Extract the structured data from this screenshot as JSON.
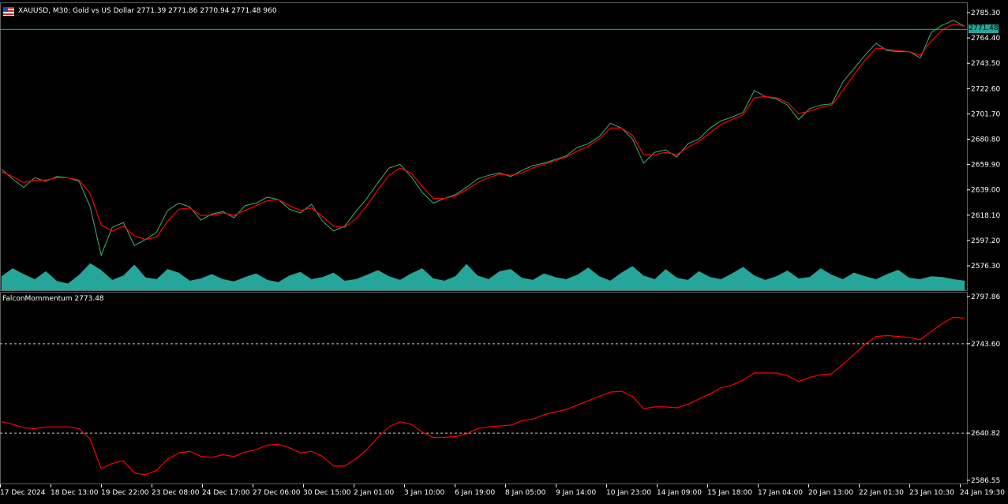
{
  "window": {
    "symbol": "XAUUSD",
    "timeframe": "M30",
    "description": "Gold vs US Dollar",
    "ohlc": [
      "2771.39",
      "2771.86",
      "2770.94",
      "2771.48"
    ],
    "volume": "960",
    "header_text": "XAUUSD, M30:  Gold vs US Dollar  2771.39 2771.86 2770.94 2771.48  960",
    "current_price_label": "2771.48"
  },
  "indicator": {
    "name": "FalconMommentum",
    "value": "2773.48",
    "header_text": "FalconMommentum 2773.48"
  },
  "colors": {
    "background": "#000000",
    "price_line": "#3cb371",
    "moving_average": "#ff0000",
    "volume": "#26a69a",
    "indicator_line": "#ff0000",
    "current_price_bg": "#26a69a",
    "axis_text": "#ffffff"
  },
  "chart_data": [
    {
      "type": "line",
      "title": "XAUUSD, M30",
      "ylim": [
        2566,
        2790
      ],
      "yticks": [
        "2785.30",
        "2764.40",
        "2743.50",
        "2722.60",
        "2701.70",
        "2680.80",
        "2659.90",
        "2639.00",
        "2618.10",
        "2597.20",
        "2576.30"
      ],
      "xticks": [
        "17 Dec 2024",
        "18 Dec 13:00",
        "19 Dec 22:00",
        "23 Dec 08:00",
        "24 Dec 17:00",
        "27 Dec 06:00",
        "30 Dec 15:00",
        "2 Jan 01:00",
        "3 Jan 10:00",
        "6 Jan 19:00",
        "8 Jan 05:00",
        "9 Jan 14:00",
        "10 Jan 23:00",
        "14 Jan 09:00",
        "15 Jan 18:00",
        "17 Jan 04:00",
        "20 Jan 13:00",
        "22 Jan 01:30",
        "23 Jan 10:30",
        "24 Jan 19:30"
      ],
      "series": [
        {
          "values": [
            2656,
            2648,
            2641,
            2649,
            2646,
            2650,
            2649,
            2646,
            2625,
            2585,
            2608,
            2612,
            2593,
            2598,
            2604,
            2622,
            2628,
            2625,
            2614,
            2619,
            2621,
            2616,
            2626,
            2628,
            2633,
            2631,
            2623,
            2620,
            2627,
            2613,
            2605,
            2609,
            2621,
            2632,
            2645,
            2657,
            2660,
            2650,
            2637,
            2628,
            2632,
            2635,
            2641,
            2648,
            2651,
            2653,
            2650,
            2655,
            2659,
            2661,
            2664,
            2667,
            2674,
            2677,
            2683,
            2694,
            2690,
            2681,
            2661,
            2670,
            2672,
            2666,
            2677,
            2681,
            2690,
            2696,
            2699,
            2703,
            2721,
            2716,
            2714,
            2709,
            2697,
            2706,
            2709,
            2710,
            2728,
            2739,
            2750,
            2760,
            2754,
            2753,
            2753,
            2748,
            2769,
            2775,
            2779,
            2774
          ]
        },
        {
          "values": [
            2654,
            2650,
            2645,
            2647,
            2647,
            2649,
            2649,
            2647,
            2636,
            2610,
            2605,
            2609,
            2601,
            2598,
            2600,
            2613,
            2623,
            2624,
            2618,
            2618,
            2620,
            2618,
            2622,
            2626,
            2630,
            2631,
            2626,
            2622,
            2624,
            2617,
            2609,
            2608,
            2615,
            2626,
            2639,
            2651,
            2657,
            2653,
            2642,
            2632,
            2632,
            2634,
            2639,
            2645,
            2649,
            2652,
            2651,
            2653,
            2657,
            2660,
            2663,
            2666,
            2671,
            2675,
            2681,
            2690,
            2690,
            2684,
            2668,
            2668,
            2670,
            2668,
            2674,
            2679,
            2686,
            2693,
            2697,
            2701,
            2715,
            2716,
            2715,
            2711,
            2702,
            2704,
            2707,
            2709,
            2721,
            2734,
            2746,
            2756,
            2755,
            2754,
            2753,
            2750,
            2762,
            2771,
            2776,
            2774
          ]
        }
      ]
    },
    {
      "type": "area",
      "title": "Volume",
      "values": [
        38,
        60,
        44,
        30,
        52,
        25,
        18,
        42,
        74,
        55,
        28,
        40,
        70,
        35,
        30,
        58,
        48,
        26,
        32,
        44,
        30,
        24,
        36,
        46,
        28,
        22,
        40,
        50,
        30,
        36,
        48,
        26,
        30,
        42,
        55,
        38,
        28,
        46,
        60,
        32,
        26,
        38,
        72,
        40,
        30,
        52,
        58,
        34,
        28,
        46,
        36,
        30,
        42,
        62,
        38,
        26,
        48,
        66,
        40,
        30,
        58,
        34,
        28,
        52,
        36,
        30,
        46,
        64,
        40,
        28,
        38,
        54,
        32,
        36,
        60,
        42,
        30,
        48,
        38,
        30,
        44,
        56,
        34,
        30,
        38,
        36,
        30,
        26
      ]
    },
    {
      "type": "line",
      "title": "FalconMommentum",
      "ylim": [
        2580,
        2802
      ],
      "yticks": [
        "2797.86",
        "2743.60",
        "2640.82",
        "2586.55"
      ],
      "levels": [
        2743.6,
        2640.82
      ],
      "values": [
        2654,
        2651,
        2647,
        2646,
        2648,
        2648,
        2648,
        2646,
        2634,
        2600,
        2606,
        2609,
        2595,
        2593,
        2598,
        2611,
        2618,
        2620,
        2614,
        2613,
        2616,
        2614,
        2619,
        2622,
        2627,
        2628,
        2624,
        2618,
        2620,
        2614,
        2603,
        2603,
        2611,
        2622,
        2636,
        2648,
        2654,
        2651,
        2642,
        2636,
        2636,
        2637,
        2640,
        2646,
        2648,
        2649,
        2650,
        2655,
        2657,
        2662,
        2665,
        2668,
        2673,
        2678,
        2683,
        2688,
        2689,
        2683,
        2669,
        2671,
        2671,
        2670,
        2674,
        2680,
        2686,
        2693,
        2696,
        2702,
        2710,
        2710,
        2710,
        2707,
        2700,
        2705,
        2708,
        2709,
        2720,
        2731,
        2743,
        2752,
        2753,
        2752,
        2751,
        2748,
        2758,
        2767,
        2774,
        2773
      ]
    }
  ]
}
